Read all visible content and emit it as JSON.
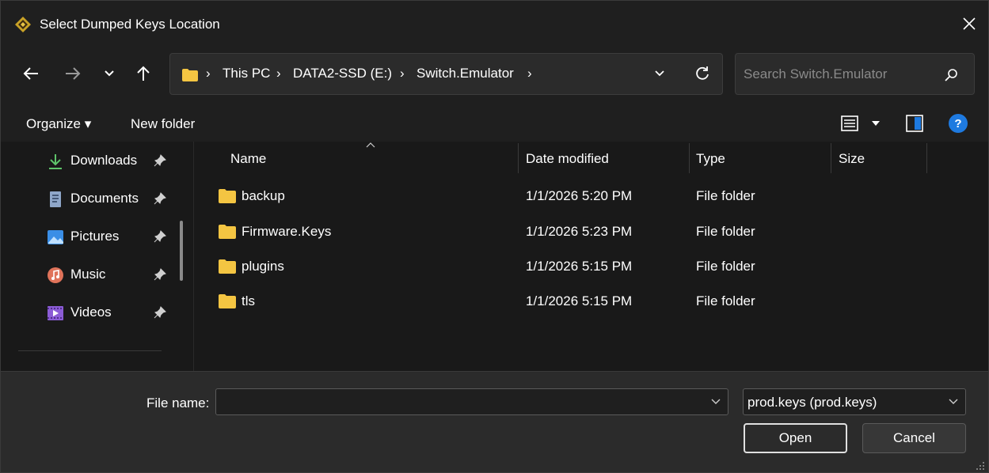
{
  "window": {
    "title": "Select Dumped Keys Location",
    "close_icon": "close-icon"
  },
  "nav": {
    "back_icon": "arrow-left-icon",
    "forward_icon": "arrow-right-icon",
    "recent_icon": "chevron-down-icon",
    "up_icon": "arrow-up-icon"
  },
  "address": {
    "breadcrumbs": [
      "This PC",
      "DATA2-SSD (E:)",
      "Switch.Emulator"
    ],
    "separator": "›"
  },
  "search": {
    "placeholder": "Search Switch.Emulator"
  },
  "commands": {
    "organize": "Organize ▾",
    "new_folder": "New folder",
    "help": "?"
  },
  "navpane": {
    "items": [
      {
        "label": "Downloads",
        "icon": "download-icon"
      },
      {
        "label": "Documents",
        "icon": "documents-icon"
      },
      {
        "label": "Pictures",
        "icon": "pictures-icon"
      },
      {
        "label": "Music",
        "icon": "music-icon"
      },
      {
        "label": "Videos",
        "icon": "videos-icon"
      }
    ]
  },
  "filelist": {
    "columns": {
      "name": "Name",
      "date": "Date modified",
      "type": "Type",
      "size": "Size"
    },
    "rows": [
      {
        "name": "backup",
        "date": "1/1/2026 5:20 PM",
        "type": "File folder"
      },
      {
        "name": "Firmware.Keys",
        "date": "1/1/2026 5:23 PM",
        "type": "File folder"
      },
      {
        "name": "plugins",
        "date": "1/1/2026 5:15 PM",
        "type": "File folder"
      },
      {
        "name": "tls",
        "date": "1/1/2026 5:15 PM",
        "type": "File folder"
      }
    ]
  },
  "footer": {
    "file_name_label": "File name:",
    "file_name_value": "",
    "file_type": "prod.keys (prod.keys)",
    "open_label": "Open",
    "cancel_label": "Cancel"
  },
  "colors": {
    "background": "#1f1f1f",
    "pane": "#191919",
    "folder": "#f4c542",
    "accent": "#1e7ae0"
  }
}
